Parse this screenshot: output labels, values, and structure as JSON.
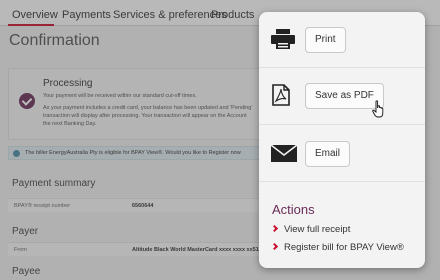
{
  "tabs": [
    {
      "label": "Overview",
      "active": true
    },
    {
      "label": "Payments"
    },
    {
      "label": "Services & preferences"
    },
    {
      "label": "Products"
    }
  ],
  "page_title": "Confirmation",
  "processing": {
    "title": "Processing",
    "lines": [
      "Your payment will be received within our standard cut-off times.",
      "As your payment includes a credit card, your balance has been updated and 'Pending'",
      "transaction will display after processing. Your transaction will appear on the Account",
      "the next Banking Day."
    ]
  },
  "info_bar": {
    "text": "The biller EnergyAustralia Pty is eligible for BPAY View®. Would you like to Register now"
  },
  "payment_summary": {
    "heading": "Payment summary",
    "receipt_label": "BPAY® receipt number",
    "receipt_value": "6560644"
  },
  "payer": {
    "heading": "Payer",
    "from_label": "From",
    "from_value": "Altitude Black World MasterCard xxxx xxxx xx51 |"
  },
  "payee": {
    "heading": "Payee"
  },
  "menu": {
    "print_label": "Print",
    "pdf_label": "Save as PDF",
    "email_label": "Email",
    "actions_title": "Actions",
    "actions": [
      "View full receipt",
      "Register bill for BPAY View®"
    ]
  },
  "colors": {
    "accent": "#6b2c5a",
    "chevron": "#c8102e",
    "tab_underline": "#c8102e"
  }
}
